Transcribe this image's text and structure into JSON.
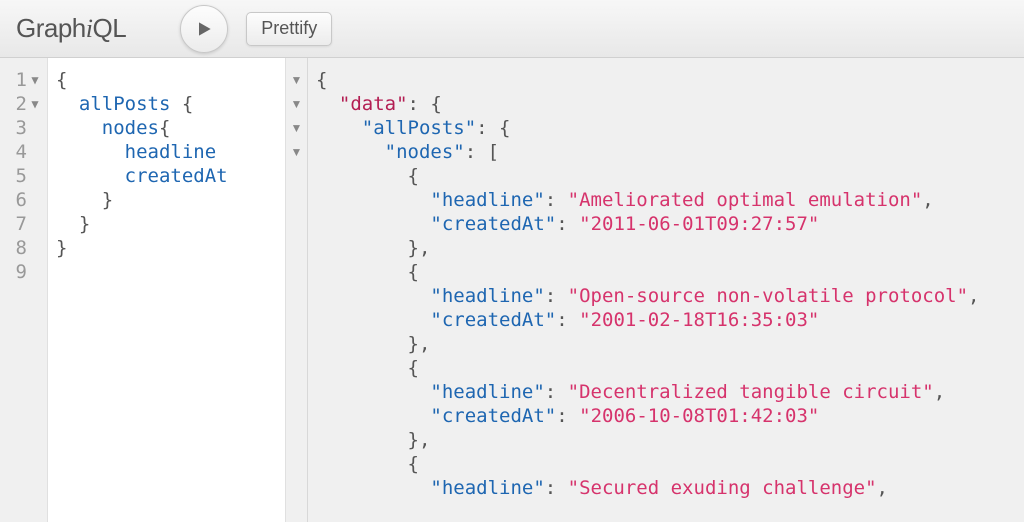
{
  "toolbar": {
    "logo_prefix": "Graph",
    "logo_i": "i",
    "logo_suffix": "QL",
    "prettify_label": "Prettify"
  },
  "query": {
    "lines": [
      {
        "n": 1,
        "fold": true,
        "indent": 0,
        "open": "{"
      },
      {
        "n": 2,
        "fold": true,
        "indent": 1,
        "field": "allPosts",
        "open": " {"
      },
      {
        "n": 3,
        "fold": false,
        "indent": 2,
        "field": "nodes",
        "open": "{"
      },
      {
        "n": 4,
        "fold": false,
        "indent": 3,
        "field": "headline"
      },
      {
        "n": 5,
        "fold": false,
        "indent": 3,
        "field": "createdAt"
      },
      {
        "n": 6,
        "fold": false,
        "indent": 2,
        "close": "}"
      },
      {
        "n": 7,
        "fold": false,
        "indent": 1,
        "close": "}"
      },
      {
        "n": 8,
        "fold": false,
        "indent": 0,
        "close": "}"
      },
      {
        "n": 9,
        "fold": false,
        "indent": 0
      }
    ]
  },
  "result": {
    "fold_rows": [
      true,
      true,
      true,
      true
    ],
    "top_key": "data",
    "root_key": "allPosts",
    "nodes_key": "nodes",
    "field_headline": "headline",
    "field_createdAt": "createdAt",
    "items": [
      {
        "headline": "Ameliorated optimal emulation",
        "createdAt": "2011-06-01T09:27:57"
      },
      {
        "headline": "Open-source non-volatile protocol",
        "createdAt": "2001-02-18T16:35:03"
      },
      {
        "headline": "Decentralized tangible circuit",
        "createdAt": "2006-10-08T01:42:03"
      },
      {
        "headline": "Secured exuding challenge",
        "createdAt": ""
      }
    ]
  }
}
